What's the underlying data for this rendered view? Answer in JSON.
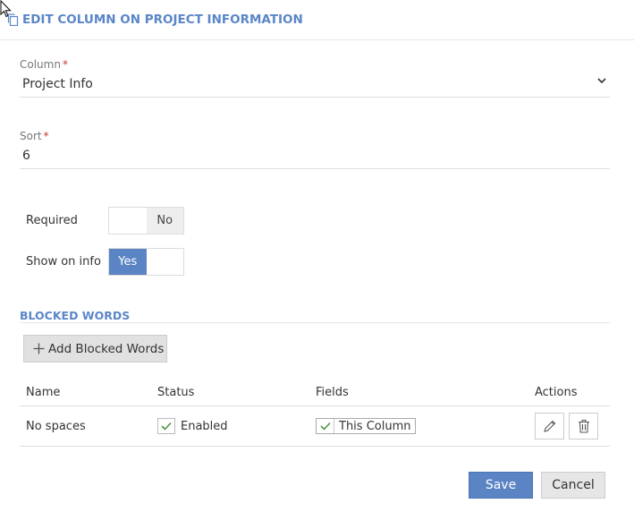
{
  "dialog": {
    "title": "EDIT COLUMN ON PROJECT INFORMATION",
    "title_icon": "copy-icon"
  },
  "form": {
    "column": {
      "label": "Column",
      "required_mark": "*",
      "value": "Project Info",
      "icon": "chevron-down-icon"
    },
    "sort": {
      "label": "Sort",
      "required_mark": "*",
      "value": "6"
    },
    "required_toggle": {
      "label": "Required",
      "state": "No",
      "active": false
    },
    "show_on_info_toggle": {
      "label": "Show on info",
      "state": "Yes",
      "active": true
    }
  },
  "blocked_words": {
    "section_title": "BLOCKED WORDS",
    "add_button_label": "Add Blocked Words",
    "add_icon": "plus-icon",
    "columns": [
      "Name",
      "Status",
      "Fields",
      "Actions"
    ],
    "rows": [
      {
        "name": "No spaces",
        "status": "Enabled",
        "status_checked": true,
        "field": "This Column",
        "field_checked": true
      }
    ],
    "row_actions": [
      "pencil-icon",
      "trash-icon"
    ]
  },
  "footer": {
    "save_label": "Save",
    "cancel_label": "Cancel"
  },
  "colors": {
    "accent": "#5a86c8",
    "primary_button": "#5b84c4",
    "check": "#4a9a3c"
  }
}
